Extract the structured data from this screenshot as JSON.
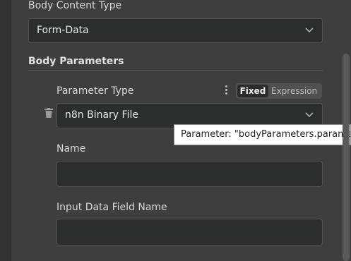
{
  "body_content_type": {
    "label": "Body Content Type",
    "value": "Form-Data"
  },
  "body_parameters": {
    "heading": "Body Parameters",
    "parameter_type": {
      "label": "Parameter Type",
      "value": "n8n Binary File",
      "mode_options": [
        "Fixed",
        "Expression"
      ],
      "selected_mode": "Fixed"
    },
    "name": {
      "label": "Name",
      "value": ""
    },
    "input_data_field_name": {
      "label": "Input Data Field Name",
      "value": ""
    }
  },
  "tooltip": {
    "text": "Parameter: \"bodyParameters.parame"
  },
  "icons": {
    "delete": "trash-icon",
    "options": "kebab-menu-icon",
    "dropdown": "chevron-down-icon"
  }
}
